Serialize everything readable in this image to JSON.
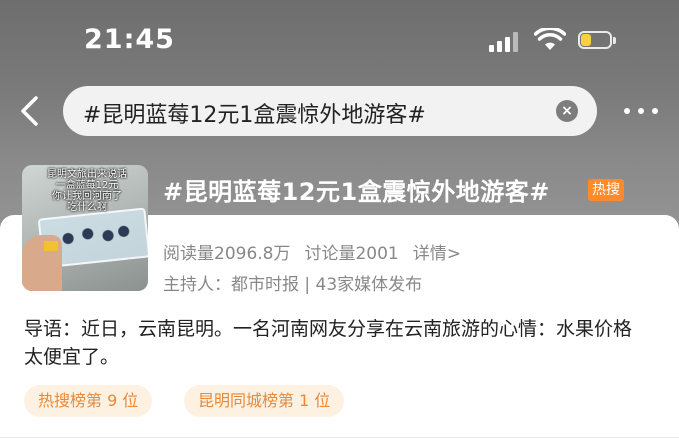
{
  "status_bar": {
    "time": "21:45"
  },
  "nav": {
    "search_text": "#昆明蓝莓12元1盒震惊外地游客#"
  },
  "topic": {
    "title": "#昆明蓝莓12元1盒震惊外地游客#",
    "hot_badge": "热搜",
    "thumbnail_caption": "昆明文旅出来说话\n一盒蓝莓12元\n你让我回河南了\n吃什么啊",
    "reads": "阅读量2096.8万",
    "discussions": "讨论量2001",
    "detail_link": "详情>",
    "host": "主持人：都市时报 | 43家媒体发布"
  },
  "intro": "导语：近日，云南昆明。一名河南网友分享在云南旅游的心情：水果价格太便宜了。",
  "tags": [
    "热搜榜第 9 位",
    "昆明同城榜第 1 位"
  ],
  "colors": {
    "accent_orange": "#ff8a2a",
    "tag_text": "#e8893a",
    "tag_bg": "#fdf1e2",
    "battery_fill": "#f7d23c"
  },
  "icons": [
    "back-arrow-icon",
    "clear-icon",
    "more-icon",
    "signal-icon",
    "wifi-icon",
    "battery-icon"
  ]
}
